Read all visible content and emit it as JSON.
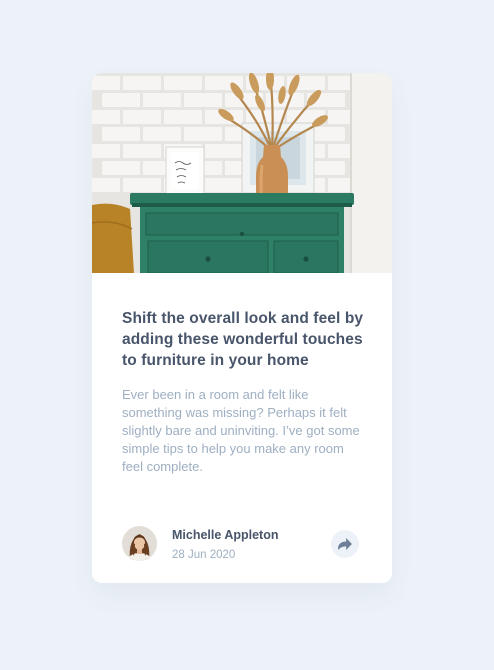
{
  "article": {
    "image_alt": "Green drawers with a vase of dried grass and framed pictures",
    "title": "Shift the overall look and feel by adding these wonderful touches to furniture in your home",
    "description": "Ever been in a room and felt like something was missing? Perhaps it felt slightly bare and uninviting. I’ve got some simple tips to help you make any room feel complete."
  },
  "author": {
    "name": "Michelle Appleton",
    "date": "28 Jun 2020",
    "avatar_icon": "avatar-photo"
  },
  "share": {
    "icon": "share-icon"
  },
  "colors": {
    "background": "#ecf2f8",
    "card": "#ffffff",
    "title": "#48556a",
    "muted": "#9eafc2",
    "share_bg": "#ecf2f8",
    "share_icon": "#6e8098"
  }
}
